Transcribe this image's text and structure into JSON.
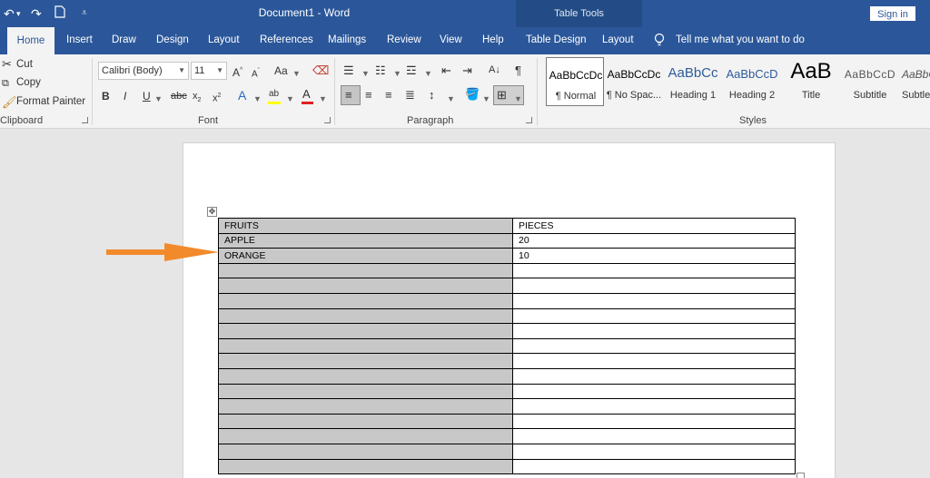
{
  "titlebar": {
    "doc_title": "Document1  -  Word",
    "table_tools": "Table Tools",
    "sign_in": "Sign in"
  },
  "tabs": {
    "home": "Home",
    "insert": "Insert",
    "draw": "Draw",
    "design": "Design",
    "layout": "Layout",
    "references": "References",
    "mailings": "Mailings",
    "review": "Review",
    "view": "View",
    "help": "Help",
    "table_design": "Table Design",
    "table_layout": "Layout",
    "tell_me": "Tell me what you want to do"
  },
  "clipboard": {
    "cut": "Cut",
    "copy": "Copy",
    "format_painter": "Format Painter",
    "group_label": "Clipboard"
  },
  "font": {
    "family": "Calibri (Body)",
    "size": "11",
    "group_label": "Font"
  },
  "paragraph": {
    "group_label": "Paragraph"
  },
  "styles": {
    "group_label": "Styles",
    "items": [
      {
        "sample": "AaBbCcDc",
        "name": "¶ Normal"
      },
      {
        "sample": "AaBbCcDc",
        "name": "¶ No Spac..."
      },
      {
        "sample": "AaBbCc",
        "name": "Heading 1"
      },
      {
        "sample": "AaBbCcD",
        "name": "Heading 2"
      },
      {
        "sample": "AaB",
        "name": "Title"
      },
      {
        "sample": "AaBbCcD",
        "name": "Subtitle"
      },
      {
        "sample": "AaBbC",
        "name": "Subtle"
      }
    ]
  },
  "table": {
    "rows": [
      [
        "FRUITS",
        "PIECES"
      ],
      [
        "APPLE",
        "20"
      ],
      [
        "ORANGE",
        "10"
      ],
      [
        "",
        ""
      ],
      [
        "",
        ""
      ],
      [
        "",
        ""
      ],
      [
        "",
        ""
      ],
      [
        "",
        ""
      ],
      [
        "",
        ""
      ],
      [
        "",
        ""
      ],
      [
        "",
        ""
      ],
      [
        "",
        ""
      ],
      [
        "",
        ""
      ],
      [
        "",
        ""
      ],
      [
        "",
        ""
      ],
      [
        "",
        ""
      ],
      [
        "",
        ""
      ]
    ]
  },
  "colors": {
    "title_bar": "#2b579a",
    "table_tools_band": "#234c86",
    "arrow": "#f28a2c",
    "shaded_column": "#c8c8c8"
  }
}
